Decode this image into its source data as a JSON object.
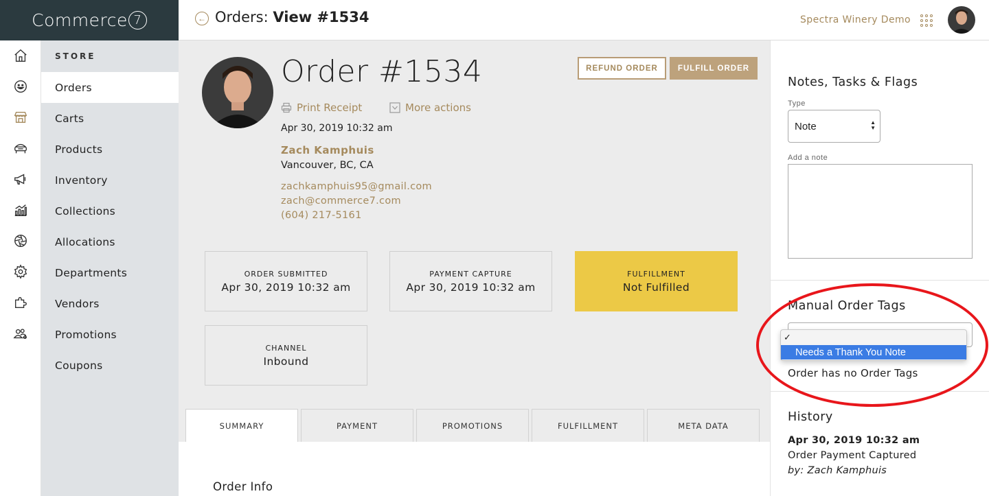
{
  "app": {
    "logo": "Commerce",
    "logo_mark": "7",
    "page_title_prefix": "Orders:",
    "page_title_main": "View #1534",
    "tenant": "Spectra Winery Demo"
  },
  "subnav": {
    "heading": "STORE",
    "items": [
      {
        "label": "Orders"
      },
      {
        "label": "Carts"
      },
      {
        "label": "Products"
      },
      {
        "label": "Inventory"
      },
      {
        "label": "Collections"
      },
      {
        "label": "Allocations"
      },
      {
        "label": "Departments"
      },
      {
        "label": "Vendors"
      },
      {
        "label": "Promotions"
      },
      {
        "label": "Coupons"
      }
    ],
    "active": "Orders"
  },
  "rail_icons": [
    "home-icon",
    "smile-icon",
    "store-icon",
    "wine-club-icon",
    "megaphone-icon",
    "reports-icon",
    "aperture-icon",
    "settings-icon",
    "puzzle-icon",
    "users-icon"
  ],
  "order": {
    "title": "Order #1534",
    "refund_label": "REFUND ORDER",
    "fulfill_label": "FULFILL ORDER",
    "print_label": "Print Receipt",
    "more_label": "More actions",
    "date": "Apr 30, 2019 10:32 am",
    "customer_name": "Zach Kamphuis",
    "customer_location": "Vancouver, BC, CA",
    "email_1": "zachkamphuis95@gmail.com",
    "email_2": "zach@commerce7.com",
    "phone": "(604) 217-5161"
  },
  "status_cards": {
    "submitted": {
      "label": "ORDER SUBMITTED",
      "value": "Apr 30, 2019 10:32 am"
    },
    "payment": {
      "label": "PAYMENT CAPTURE",
      "value": "Apr 30, 2019 10:32 am"
    },
    "fulfillment": {
      "label": "FULFILLMENT",
      "value": "Not Fulfilled"
    },
    "channel": {
      "label": "CHANNEL",
      "value": "Inbound"
    }
  },
  "tabs": [
    "SUMMARY",
    "PAYMENT",
    "PROMOTIONS",
    "FULFILLMENT",
    "META DATA"
  ],
  "active_tab": "SUMMARY",
  "content": {
    "section_title": "Order Info"
  },
  "right_panel": {
    "notes_heading": "Notes, Tasks & Flags",
    "type_label": "Type",
    "type_value": "Note",
    "add_note_label": "Add a note",
    "tags_heading": "Manual Order Tags",
    "dropdown_blank": "✓",
    "dropdown_option": "Needs a Thank You Note",
    "no_tags_text": "Order has no Order Tags",
    "history_heading": "History",
    "history": [
      {
        "date": "Apr 30, 2019 10:32 am",
        "event": "Order Payment Captured",
        "by": "by: Zach Kamphuis"
      }
    ]
  },
  "colors": {
    "brand_dark": "#2b3a3f",
    "accent_gold": "#a58a5d",
    "fulfillment_yellow": "#ecc946",
    "select_blue": "#3b7ce4",
    "annotation_red": "#e8161b"
  }
}
